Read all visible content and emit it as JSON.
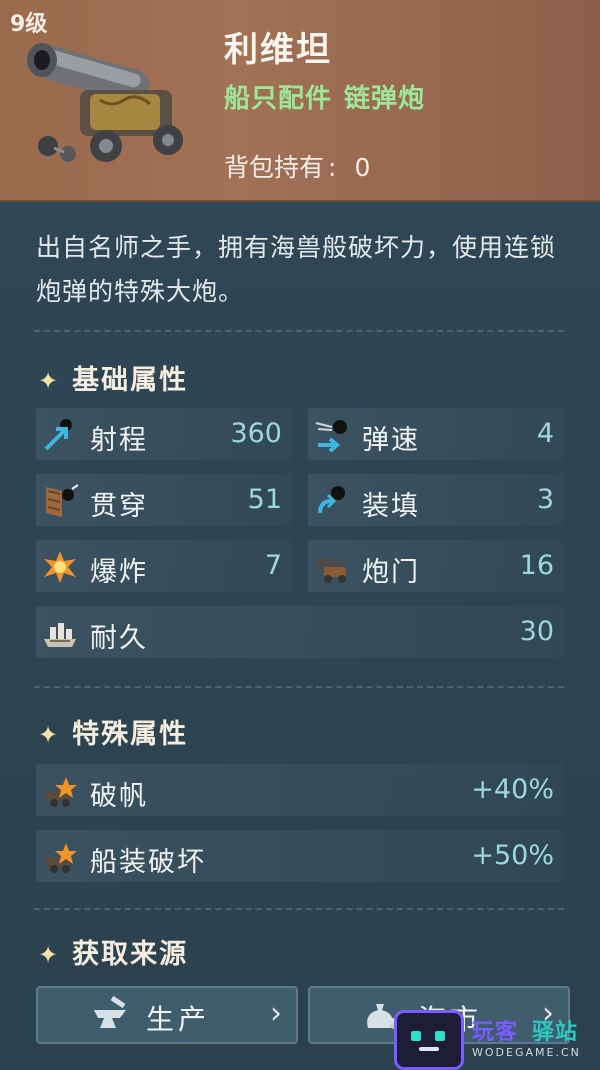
{
  "header": {
    "level": "9级",
    "item_name": "利维坦",
    "category": "船只配件",
    "subcategory": "链弹炮",
    "held_label": "背包持有",
    "held_colon": ":",
    "held_value": "0",
    "item_icon": "cannon-icon"
  },
  "description": "出自名师之手，拥有海兽般破坏力，使用连锁炮弹的特殊大炮。",
  "base_section": {
    "title": "基础属性",
    "stats": [
      {
        "label": "射程",
        "value": "360",
        "icon": "range-icon"
      },
      {
        "label": "弹速",
        "value": "4",
        "icon": "projectile-speed-icon"
      },
      {
        "label": "贯穿",
        "value": "51",
        "icon": "penetration-icon"
      },
      {
        "label": "装填",
        "value": "3",
        "icon": "reload-icon"
      },
      {
        "label": "爆炸",
        "value": "7",
        "icon": "explosion-icon"
      },
      {
        "label": "炮门",
        "value": "16",
        "icon": "gun-port-icon"
      },
      {
        "label": "耐久",
        "value": "30",
        "icon": "durability-icon"
      }
    ]
  },
  "special_section": {
    "title": "特殊属性",
    "stats": [
      {
        "label": "破帆",
        "value": "+40%",
        "icon": "sail-break-icon"
      },
      {
        "label": "船装破坏",
        "value": "+50%",
        "icon": "ship-gear-break-icon"
      }
    ]
  },
  "source_section": {
    "title": "获取来源",
    "buttons": [
      {
        "label": "生产",
        "icon": "anvil-icon"
      },
      {
        "label": "海市",
        "icon": "money-bag-icon"
      }
    ]
  },
  "watermark": {
    "text1": "玩客",
    "text2": "驿站",
    "url": "WODEGAME.CN"
  },
  "colors": {
    "accent_green": "#9be89a",
    "value_cyan": "#9fd7e0",
    "header_bg": "#9a6a4d",
    "panel_bg": "#2c4250"
  }
}
